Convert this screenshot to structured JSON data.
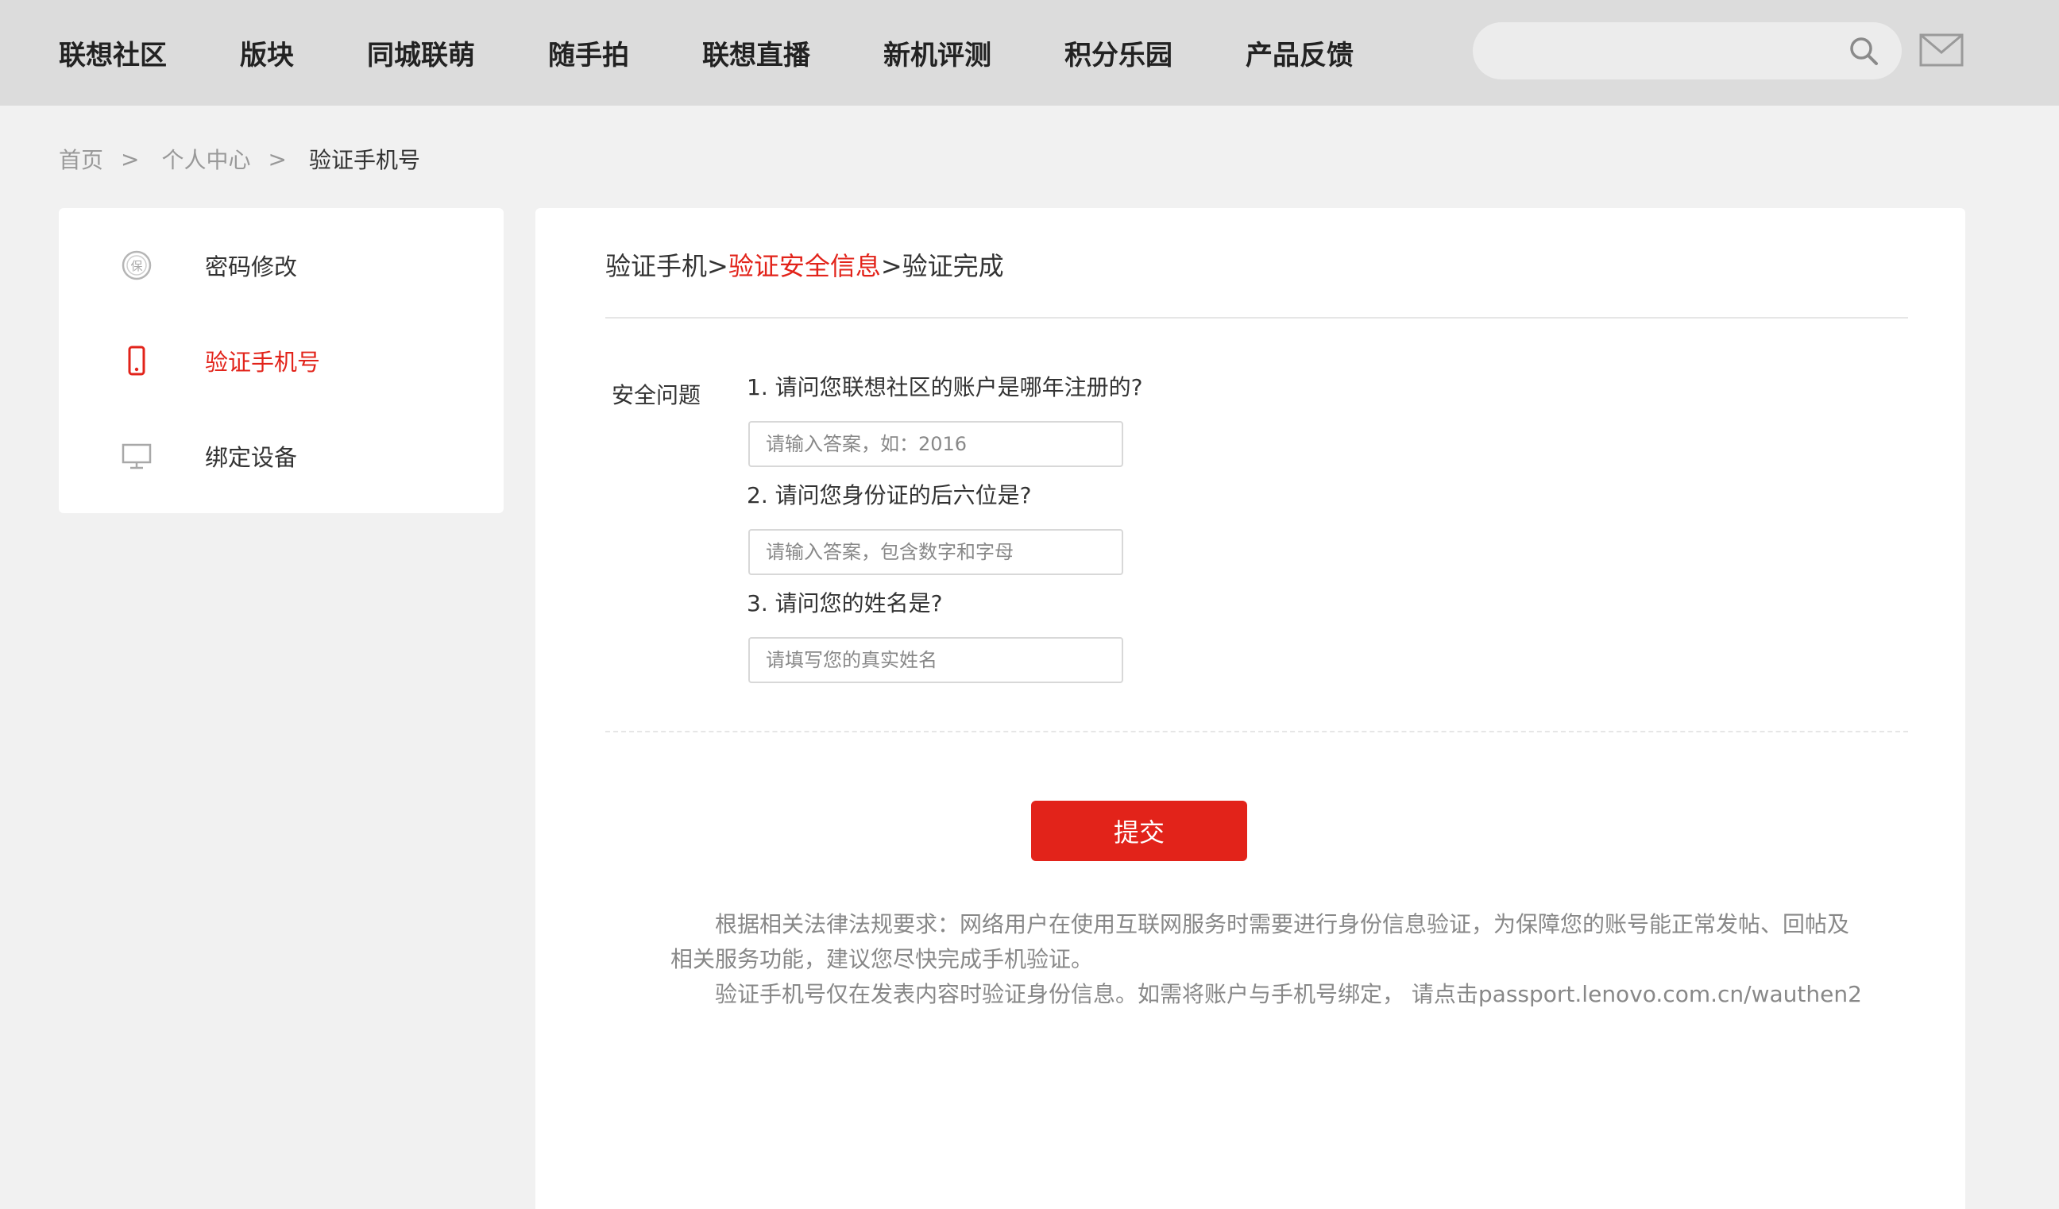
{
  "nav": {
    "items": [
      "联想社区",
      "版块",
      "同城联萌",
      "随手拍",
      "联想直播",
      "新机评测",
      "积分乐园",
      "产品反馈"
    ],
    "search": {
      "value": "",
      "placeholder": ""
    },
    "icons": {
      "search": "search-icon",
      "mail": "mail-icon"
    }
  },
  "breadcrumb": {
    "items": [
      "首页",
      "个人中心"
    ],
    "separator": ">",
    "current": "验证手机号"
  },
  "sidebar": {
    "items": [
      {
        "label": "密码修改",
        "icon": "shield-badge-icon",
        "active": false
      },
      {
        "label": "验证手机号",
        "icon": "phone-icon",
        "active": true
      },
      {
        "label": "绑定设备",
        "icon": "monitor-icon",
        "active": false
      }
    ]
  },
  "main": {
    "steps": {
      "step1": "验证手机",
      "sep1": ">",
      "step2": "验证安全信息",
      "sep2": ">",
      "step3": "验证完成"
    },
    "security_label": "安全问题",
    "questions": [
      {
        "text": "1. 请问您联想社区的账户是哪年注册的?",
        "value": "",
        "placeholder": "请输入答案，如：2016"
      },
      {
        "text": "2. 请问您身份证的后六位是?",
        "value": "",
        "placeholder": "请输入答案，包含数字和字母"
      },
      {
        "text": "3. 请问您的姓名是?",
        "value": "",
        "placeholder": "请填写您的真实姓名"
      }
    ],
    "submit_label": "提交",
    "notice": {
      "line1": "根据相关法律法规要求：网络用户在使用互联网服务时需要进行身份信息验证，为保障您的账号能正常发帖、回帖及相关服务功能，建议您尽快完成手机验证。",
      "line2": "验证手机号仅在发表内容时验证身份信息。如需将账户与手机号绑定， 请点击passport.lenovo.com.cn/wauthen2"
    }
  },
  "colors": {
    "accent": "#e2231a",
    "topbar": "#dcdcdc",
    "background": "#f1f1f1"
  }
}
